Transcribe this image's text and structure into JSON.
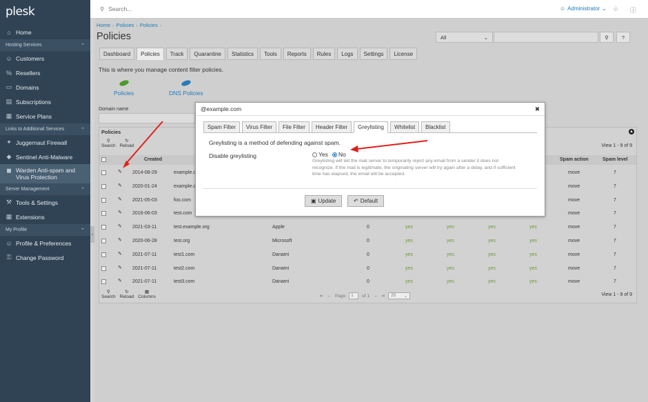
{
  "sidebar": {
    "logo": "plesk",
    "home": "Home",
    "groups": {
      "hosting": "Hosting Services",
      "links": "Links to Additional Services",
      "server": "Server Management",
      "profile": "My Profile"
    },
    "hosting_items": [
      "Customers",
      "Resellers",
      "Domains",
      "Subscriptions",
      "Service Plans"
    ],
    "links_items": [
      "Juggernaut Firewall",
      "Sentinel Anti-Malware"
    ],
    "active_item_line1": "Warden Anti-spam and",
    "active_item_line2": "Virus Protection",
    "server_items": [
      "Tools & Settings",
      "Extensions"
    ],
    "profile_items": [
      "Profile & Preferences",
      "Change Password"
    ]
  },
  "topbar": {
    "search_placeholder": "Search...",
    "user": "Administrator"
  },
  "breadcrumb": [
    "Home",
    "Policies",
    "Policies"
  ],
  "page_title": "Policies",
  "filter": {
    "selected": "All"
  },
  "tabs": [
    "Dashboard",
    "Policies",
    "Track",
    "Quarantine",
    "Statistics",
    "Tools",
    "Reports",
    "Rules",
    "Logs",
    "Settings",
    "License"
  ],
  "active_tab": "Policies",
  "intro": "This is where you manage content filter policies.",
  "icon_buttons": [
    "Policies",
    "DNS Policies"
  ],
  "domain_label": "Domain name",
  "panel": {
    "title": "Policies",
    "tools": [
      "Search",
      "Reload"
    ],
    "footer_tools": [
      "Search",
      "Reload",
      "Columns"
    ],
    "count": "View 1 - 9 of 9",
    "headers": {
      "created": "Created",
      "spam_action": "Spam action",
      "spam_level": "Spam level"
    },
    "rows": [
      {
        "date": "2014-08-29",
        "domain": "example.c",
        "owner": "",
        "count": "",
        "y": [
          "",
          "",
          "",
          ""
        ],
        "action": "move",
        "level": "7"
      },
      {
        "date": "2020-01-24",
        "domain": "example.o",
        "owner": "",
        "count": "",
        "y": [
          "",
          "",
          "",
          ""
        ],
        "action": "move",
        "level": "7"
      },
      {
        "date": "2021-05-03",
        "domain": "foo.com",
        "owner": "",
        "count": "",
        "y": [
          "",
          "",
          "",
          ""
        ],
        "action": "move",
        "level": "7"
      },
      {
        "date": "2016-06-03",
        "domain": "test.com",
        "owner": "",
        "count": "",
        "y": [
          "",
          "",
          "",
          ""
        ],
        "action": "move",
        "level": "7"
      },
      {
        "date": "2021-03-11",
        "domain": "test.example.org",
        "owner": "Apple",
        "count": "0",
        "y": [
          "yes",
          "yes",
          "yes",
          "yes"
        ],
        "action": "move",
        "level": "7"
      },
      {
        "date": "2020-06-28",
        "domain": "test.org",
        "owner": "Microsoft",
        "count": "0",
        "y": [
          "yes",
          "yes",
          "yes",
          "yes"
        ],
        "action": "move",
        "level": "7"
      },
      {
        "date": "2021-07-11",
        "domain": "test1.com",
        "owner": "Danami",
        "count": "0",
        "y": [
          "yes",
          "yes",
          "yes",
          "yes"
        ],
        "action": "move",
        "level": "7"
      },
      {
        "date": "2021-07-11",
        "domain": "test2.com",
        "owner": "Danami",
        "count": "0",
        "y": [
          "yes",
          "yes",
          "yes",
          "yes"
        ],
        "action": "move",
        "level": "7"
      },
      {
        "date": "2021-07-11",
        "domain": "test3.com",
        "owner": "Danami",
        "count": "0",
        "y": [
          "yes",
          "yes",
          "yes",
          "yes"
        ],
        "action": "move",
        "level": "7"
      }
    ],
    "pager": {
      "page_label": "Page",
      "page": "1",
      "of": "of 1",
      "per_page": "25"
    }
  },
  "modal": {
    "title": "@example.com",
    "tabs": [
      "Spam Filter",
      "Virus Filter",
      "File Filter",
      "Header Filter",
      "Greylisting",
      "Whitelist",
      "Blacklist"
    ],
    "active_tab": "Greylisting",
    "description": "Greylisting is a method of defending against spam.",
    "field_label": "Disable greylisting",
    "yes": "Yes",
    "no": "No",
    "help": "Greylisting will tell the mail server to temporarily reject any email from a sender it does not recognize. If the mail is legitimate, the originating server will try again after a delay, and if sufficient time has elapsed, the email will be accepted.",
    "update": "Update",
    "default": "Default"
  },
  "colors": {
    "sidebar": "#2f4354",
    "link": "#1e7bb8",
    "annotation": "#e0201b"
  }
}
